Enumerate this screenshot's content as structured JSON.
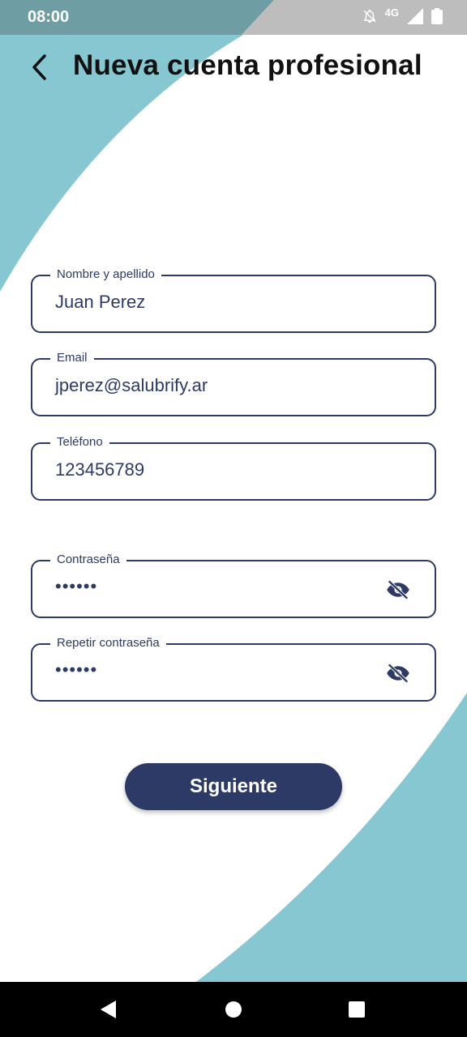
{
  "colors": {
    "accent_teal": "#86c7d1",
    "status_bar_teal": "#6e9da3",
    "status_bar_gray": "#bdbdbd",
    "field_border": "#2d3a66",
    "button_bg": "#2e3a66"
  },
  "status_bar": {
    "time": "08:00",
    "network": "4G",
    "icons": [
      "notifications-off-icon",
      "signal-icon",
      "battery-icon"
    ]
  },
  "app_bar": {
    "title": "Nueva cuenta profesional",
    "back_icon": "chevron-left-icon"
  },
  "form": {
    "name": {
      "label": "Nombre y apellido",
      "value": "Juan Perez"
    },
    "email": {
      "label": "Email",
      "value": "jperez@salubrify.ar"
    },
    "phone": {
      "label": "Teléfono",
      "value": "123456789"
    },
    "password": {
      "label": "Contraseña",
      "value": "••••••",
      "icon": "eye-off-icon"
    },
    "repeat_password": {
      "label": "Repetir contraseña",
      "value": "••••••",
      "icon": "eye-off-icon"
    }
  },
  "actions": {
    "next_label": "Siguiente"
  },
  "nav_bar": {
    "back": "triangle-back-icon",
    "home": "circle-home-icon",
    "recents": "square-recents-icon"
  }
}
